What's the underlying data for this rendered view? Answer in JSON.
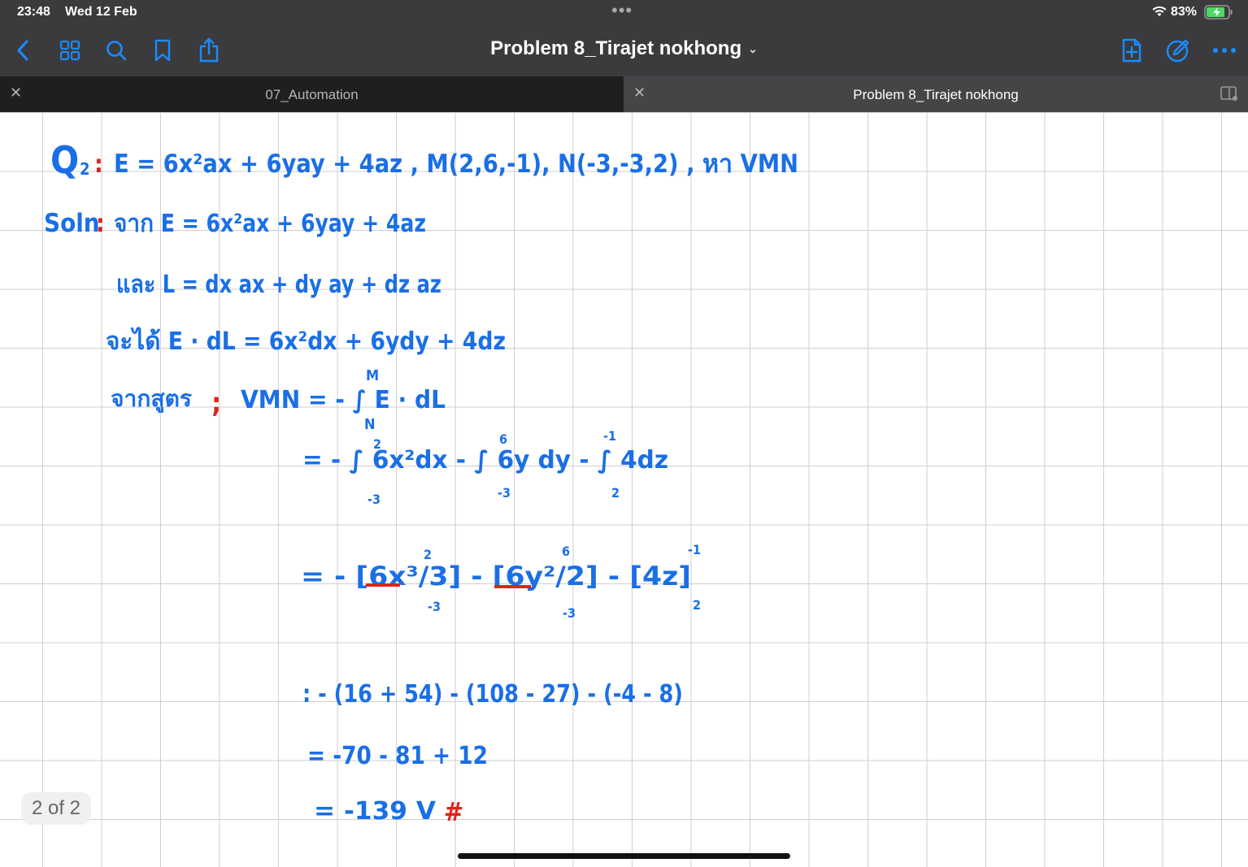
{
  "status": {
    "time": "23:48",
    "date": "Wed 12 Feb",
    "battery": "83%"
  },
  "toolbar": {
    "title": "Problem 8_Tirajet nokhong",
    "icons": [
      "back-icon",
      "grid-icon",
      "search-icon",
      "bookmark-icon",
      "share-icon",
      "add-page-icon",
      "pencil-icon",
      "more-icon"
    ]
  },
  "tabs": [
    {
      "label": "07_Automation",
      "active": false
    },
    {
      "label": "Problem 8_Tirajet nokhong",
      "active": true
    }
  ],
  "page_indicator": "2 of 2",
  "colors": {
    "toolbar_bg": "#3b3b3d",
    "ink_blue": "#1a6fe6",
    "ink_red": "#e2211c",
    "battery_green": "#4cd964"
  },
  "notes": {
    "q_label": "Q",
    "q_sub": "2",
    "q_colon": ":",
    "q_text": "E = 6x²ax + 6yay + 4az , M(2,6,-1), N(-3,-3,2) , หา VMN",
    "soln_label": "Soln",
    "soln_colon": ":",
    "line1": "จาก  E = 6x²ax + 6yay + 4az",
    "line2": "และ  L = dx ax + dy ay + dz az",
    "line3": "จะได้  E · dL  = 6x²dx + 6ydy + 4dz",
    "line4_head": "จากสูตร",
    "line4_semi": ";",
    "line4_body": "VMN  =  - ∫ E · dL",
    "line4_upper": "M",
    "line4_lower": "N",
    "line5": "=  - ∫ 6x²dx - ∫ 6y dy - ∫ 4dz",
    "line5_limits": [
      "2",
      "-3",
      "6",
      "-3",
      "-1",
      "2"
    ],
    "line6": "=  - [6x³/3]  - [6y²/2]  - [4z]",
    "line6_limits": [
      "2",
      "-3",
      "6",
      "-3",
      "-1",
      "2"
    ],
    "line7": ":  - (16 + 54) - (108 - 27) - (-4 - 8)",
    "line8": "=  -70 - 81 + 12",
    "line9": "=  -139 V",
    "line9_end": "#"
  }
}
